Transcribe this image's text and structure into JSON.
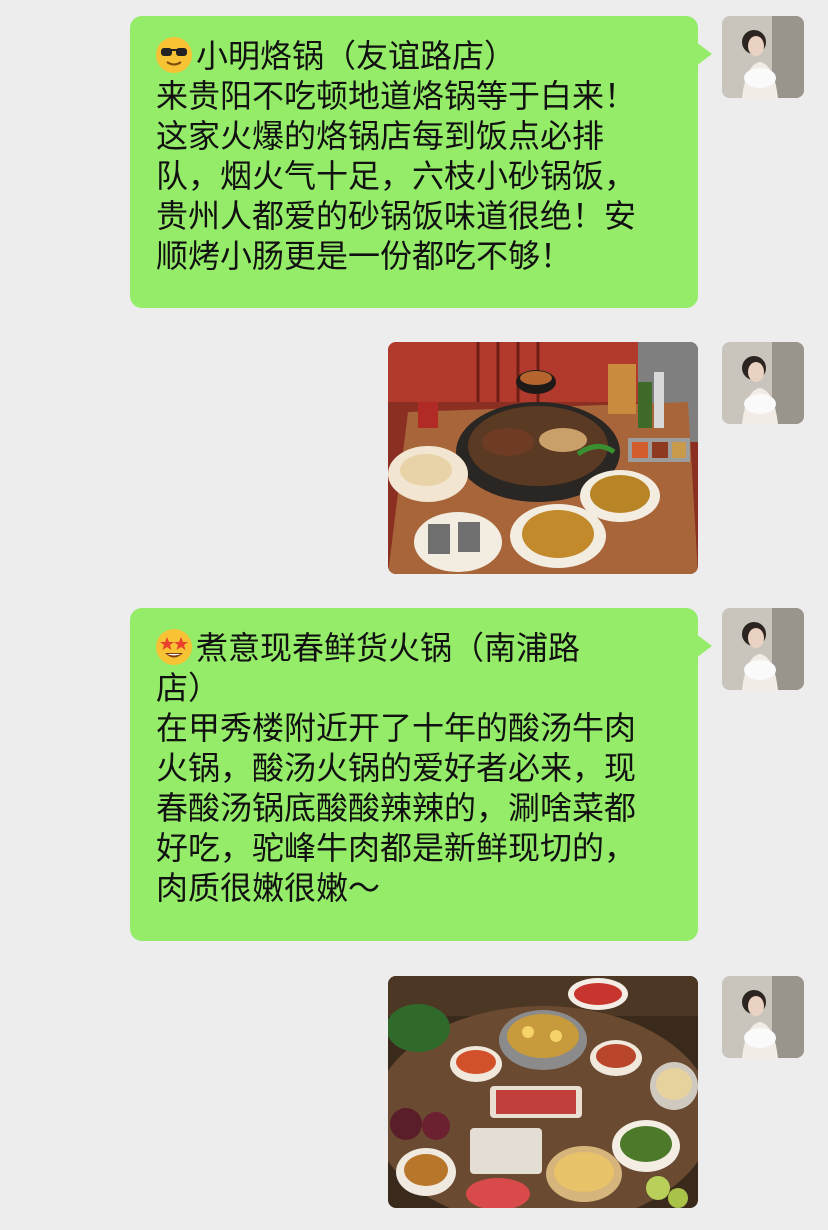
{
  "messages": [
    {
      "type": "text",
      "emoji": "sunglasses-emoji",
      "lines": [
        "小明烙锅（友谊路店）",
        "来贵阳不吃顿地道烙锅等于白来！",
        "这家火爆的烙锅店每到饭点必排",
        "队，烟火气十足，六枝小砂锅饭，",
        "贵州人都爱的砂锅饭味道很绝！安",
        "顺烤小肠更是一份都吃不够！"
      ]
    },
    {
      "type": "image",
      "subject": "hotpot-table-photo"
    },
    {
      "type": "text",
      "emoji": "star-struck-emoji",
      "lines": [
        "煮意现春鲜货火锅（南浦路",
        "店）",
        "在甲秀楼附近开了十年的酸汤牛肉",
        "火锅，酸汤火锅的爱好者必来，现",
        "春酸汤锅底酸酸辣辣的，涮啥菜都",
        "好吃，驼峰牛肉都是新鲜现切的，",
        "肉质很嫩很嫩～"
      ]
    },
    {
      "type": "image",
      "subject": "sour-soup-hotpot-spread-photo"
    }
  ],
  "colors": {
    "bubble": "#95ec69",
    "background": "#ededed"
  }
}
